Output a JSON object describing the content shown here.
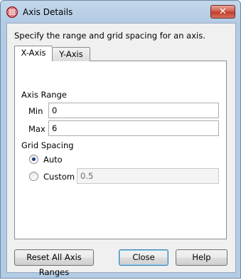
{
  "window": {
    "title": "Axis Details",
    "close_glyph": "✕",
    "app_icon": "grid-globe-icon"
  },
  "instructions": "Specify the range and grid spacing for an axis.",
  "tabs": [
    {
      "label": "X-Axis",
      "selected": true
    },
    {
      "label": "Y-Axis",
      "selected": false
    }
  ],
  "axis_range": {
    "heading": "Axis Range",
    "min_label": "Min",
    "min_value": "0",
    "max_label": "Max",
    "max_value": "6"
  },
  "grid_spacing": {
    "heading": "Grid Spacing",
    "auto_label": "Auto",
    "auto_selected": true,
    "custom_label": "Custom",
    "custom_selected": false,
    "custom_value": "0.5",
    "custom_enabled": false
  },
  "buttons": {
    "reset": "Reset All Axis Ranges",
    "close": "Close",
    "help": "Help"
  },
  "colors": {
    "title_gradient_top": "#c4d7ea",
    "client_bg": "#f0f0f0",
    "close_button_red": "#c03a28",
    "radio_dot": "#1f3b7a",
    "default_button_border": "#3c7fb1"
  }
}
